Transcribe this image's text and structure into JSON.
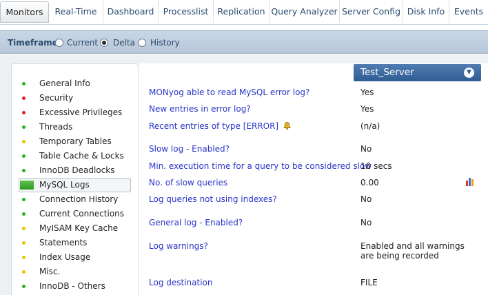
{
  "tabs": [
    {
      "label": "Monitors",
      "active": true
    },
    {
      "label": "Real-Time",
      "active": false
    },
    {
      "label": "Dashboard",
      "active": false
    },
    {
      "label": "Processlist",
      "active": false
    },
    {
      "label": "Replication",
      "active": false
    },
    {
      "label": "Query Analyzer",
      "active": false
    },
    {
      "label": "Server Config",
      "active": false
    },
    {
      "label": "Disk Info",
      "active": false
    },
    {
      "label": "Events",
      "active": false
    }
  ],
  "timeframe": {
    "label": "Timeframe",
    "options": [
      {
        "label": "Current",
        "selected": false
      },
      {
        "label": "Delta",
        "selected": true
      },
      {
        "label": "History",
        "selected": false
      }
    ]
  },
  "colors": {
    "status_green": "#22b422",
    "status_red": "#e02020",
    "status_yellow": "#e5c400",
    "link_blue": "#2a35c8",
    "server_bar": "#3a6aa0"
  },
  "sidebar": {
    "items": [
      {
        "label": "General Info",
        "status": "green"
      },
      {
        "label": "Security",
        "status": "red"
      },
      {
        "label": "Excessive Privileges",
        "status": "red"
      },
      {
        "label": "Threads",
        "status": "green"
      },
      {
        "label": "Temporary Tables",
        "status": "yellow"
      },
      {
        "label": "Table Cache & Locks",
        "status": "green"
      },
      {
        "label": "InnoDB Deadlocks",
        "status": "green"
      },
      {
        "label": "MySQL Logs",
        "status": "green",
        "active": true
      },
      {
        "label": "Connection History",
        "status": "green"
      },
      {
        "label": "Current Connections",
        "status": "green"
      },
      {
        "label": "MyISAM Key Cache",
        "status": "yellow"
      },
      {
        "label": "Statements",
        "status": "yellow"
      },
      {
        "label": "Index Usage",
        "status": "yellow"
      },
      {
        "label": "Misc.",
        "status": "yellow"
      },
      {
        "label": "InnoDB - Others",
        "status": "green"
      }
    ]
  },
  "server": {
    "name": "Test_Server",
    "dropdown_icon": "chevron-down-icon"
  },
  "rows": [
    {
      "label": "MONyog able to read MySQL error log?",
      "value": "Yes"
    },
    {
      "label": "New entries in error log?",
      "value": "Yes"
    },
    {
      "label": "Recent entries of type [ERROR]",
      "value": "(n/a)",
      "icon": "bell-icon"
    },
    {
      "label": "Slow log - Enabled?",
      "value": "No"
    },
    {
      "label": "Min. execution time for a query to be considered slow",
      "value": "10 secs"
    },
    {
      "label": "No. of slow queries",
      "value": "0.00",
      "icon": "bar-chart-icon"
    },
    {
      "label": "Log queries not using indexes?",
      "value": "No"
    },
    {
      "label": "General log - Enabled?",
      "value": "No"
    },
    {
      "label": "Log warnings?",
      "value": "Enabled and all warnings",
      "value2": "are being recorded"
    },
    {
      "label": "Log destination",
      "value": "FILE"
    }
  ]
}
